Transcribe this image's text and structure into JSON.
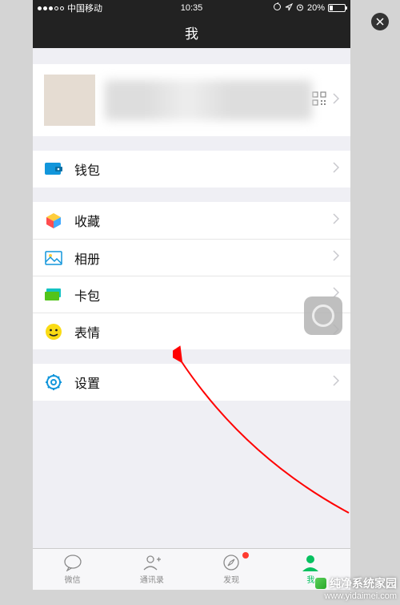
{
  "status_bar": {
    "carrier": "中国移动",
    "time": "10:35",
    "battery_pct": "20%"
  },
  "nav": {
    "title": "我"
  },
  "menu": {
    "wallet": "钱包",
    "favorites": "收藏",
    "album": "相册",
    "cards": "卡包",
    "stickers": "表情",
    "settings": "设置"
  },
  "tabs": {
    "chat": "微信",
    "contacts": "通讯录",
    "discover": "发现",
    "me": "我"
  },
  "watermark": {
    "brand": "纯净系统家园",
    "url": "www.yidaimei.com"
  }
}
